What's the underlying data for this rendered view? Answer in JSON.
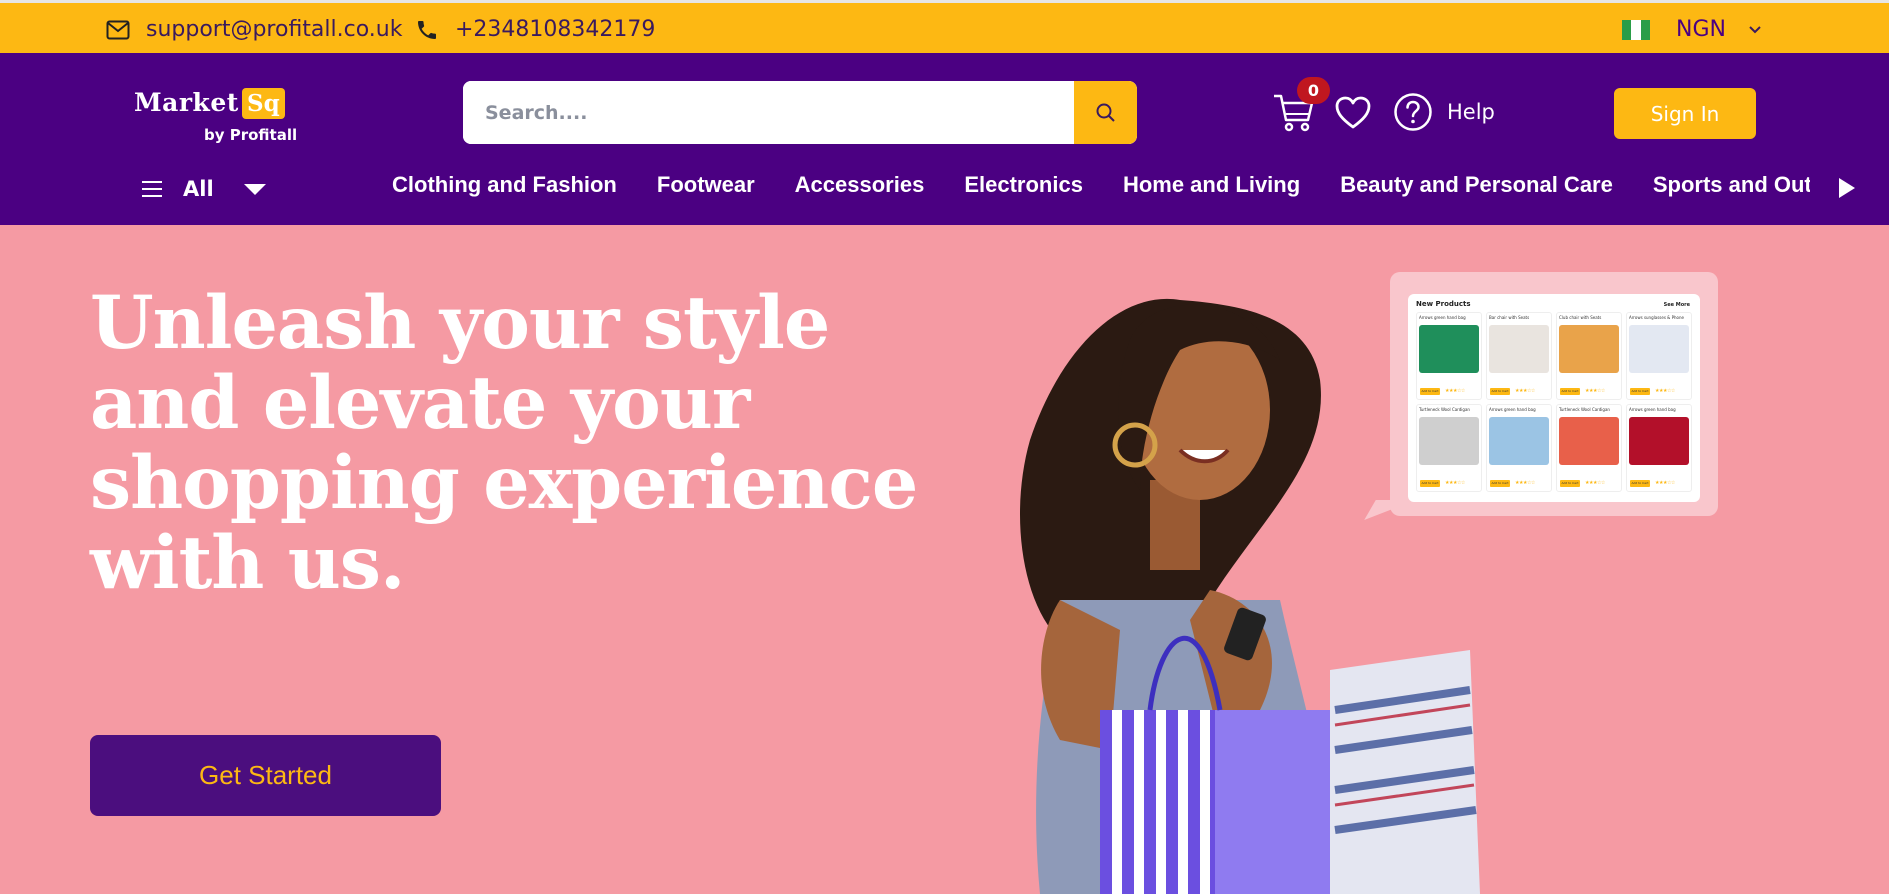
{
  "topbar": {
    "email": "support@profitall.co.uk",
    "phone": "+2348108342179",
    "currency": "NGN"
  },
  "header": {
    "logo_word": "Market",
    "logo_badge": "Sq",
    "logo_sub": "by Profitall",
    "search_placeholder": "Search....",
    "cart_count": "0",
    "help_label": "Help",
    "signin_label": "Sign In"
  },
  "nav": {
    "all_label": "All",
    "categories": [
      "Clothing and Fashion",
      "Footwear",
      "Accessories",
      "Electronics",
      "Home and Living",
      "Beauty and Personal Care",
      "Sports and Outdoors"
    ]
  },
  "hero": {
    "title": "Unleash your style and elevate your shopping experience with us.",
    "cta_label": "Get Started"
  },
  "preview_panel": {
    "title": "New Products",
    "see_all": "See More",
    "cards": [
      {
        "name": "Arrows green hand bag",
        "color": "#1f8f5b"
      },
      {
        "name": "Bar chair with Seats",
        "color": "#e9e4df"
      },
      {
        "name": "Club chair with Seats",
        "color": "#e9a34a"
      },
      {
        "name": "Arrows sunglasses & Phone",
        "color": "#e3e8f2"
      },
      {
        "name": "Turtleneck Wool Cardigan",
        "color": "#cfcfcf"
      },
      {
        "name": "Arrows green hand bag",
        "color": "#9bc4e4"
      },
      {
        "name": "Turtleneck Wool Cardigan",
        "color": "#e8604a"
      },
      {
        "name": "Arrows green hand bag",
        "color": "#b3102a"
      }
    ],
    "add_label": "Add to Cart",
    "stars": "★★★☆☆"
  },
  "colors": {
    "brand_purple": "#4b0082",
    "accent_yellow": "#fdb813",
    "hero_pink": "#f59aa3"
  }
}
